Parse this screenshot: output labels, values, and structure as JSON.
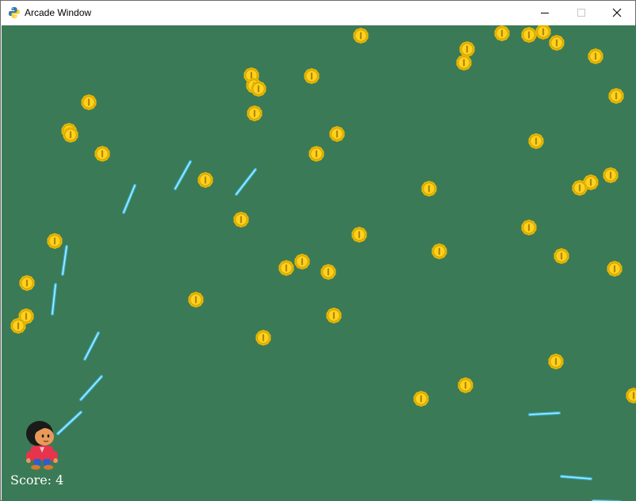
{
  "window": {
    "title": "Arcade Window",
    "app_icon": "python-logo-icon",
    "buttons": {
      "minimize": "minimize-icon",
      "maximize": "maximize-icon",
      "close": "close-icon"
    }
  },
  "game": {
    "background_color": "#3b7a57",
    "score_text": "Score: 4",
    "player": "player-character",
    "sprites": {
      "coin": "gold-coin",
      "laser": "blue-laser-bolt"
    },
    "colors": {
      "coin_outer": "#e8b800",
      "coin_inner": "#ffd21f",
      "laser": "#9ff0ff",
      "laser_glow": "#3fb8e8",
      "text": "#ffffff"
    }
  }
}
